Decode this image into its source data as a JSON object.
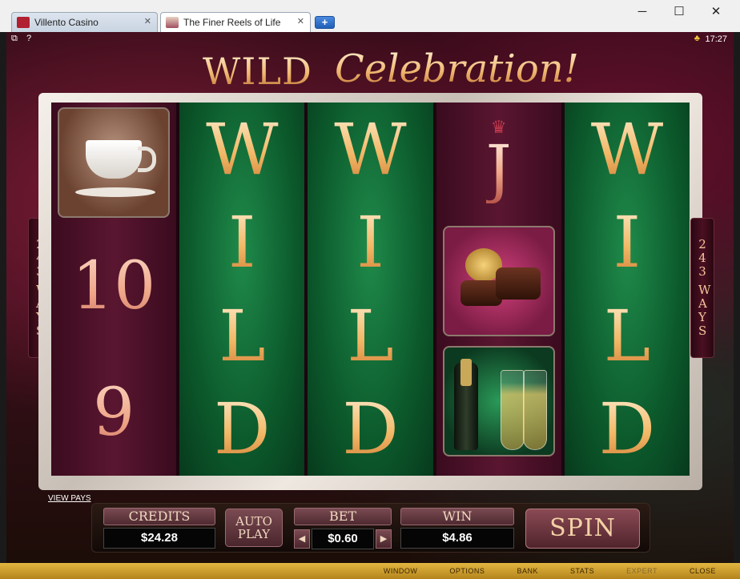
{
  "browser": {
    "tabs": [
      {
        "label": "Villento Casino"
      },
      {
        "label": "The Finer Reels of Life"
      }
    ],
    "new_tab": "+",
    "window_controls": {
      "minimize": "─",
      "maximize": "☐",
      "close": "✕"
    }
  },
  "game": {
    "top_icons": {
      "copy": "⧉",
      "help": "?"
    },
    "clock": "17:27",
    "title": {
      "wild": "WILD",
      "celebration": "Celebration!"
    },
    "ways": {
      "number": "243",
      "word": "WAYS"
    },
    "reels": {
      "reel1": {
        "symbols": [
          "coffee-cup",
          "10",
          "9"
        ]
      },
      "reel2": {
        "wild_letters": [
          "W",
          "I",
          "L",
          "D"
        ]
      },
      "reel3": {
        "wild_letters": [
          "W",
          "I",
          "L",
          "D"
        ]
      },
      "reel4": {
        "symbols": [
          "J",
          "chocolates",
          "champagne"
        ]
      },
      "reel5": {
        "wild_letters": [
          "W",
          "I",
          "L",
          "D"
        ]
      }
    },
    "view_pays": "VIEW PAYS",
    "panel": {
      "credits_label": "CREDITS",
      "credits_value": "$24.28",
      "autoplay_line1": "AUTO",
      "autoplay_line2": "PLAY",
      "bet_label": "BET",
      "bet_value": "$0.60",
      "bet_decrease": "◀",
      "bet_increase": "▶",
      "win_label": "WIN",
      "win_value": "$4.86",
      "spin_label": "SPIN"
    },
    "menu": [
      {
        "label": "WINDOW",
        "enabled": true
      },
      {
        "label": "OPTIONS",
        "enabled": true
      },
      {
        "label": "BANK",
        "enabled": true
      },
      {
        "label": "STATS",
        "enabled": true
      },
      {
        "label": "EXPERT",
        "enabled": false
      },
      {
        "label": "CLOSE",
        "enabled": true
      }
    ]
  },
  "colors": {
    "gold": "#f2b866",
    "maroon": "#5a1630",
    "green": "#1f8a4a",
    "menubar": "#d2a332"
  }
}
